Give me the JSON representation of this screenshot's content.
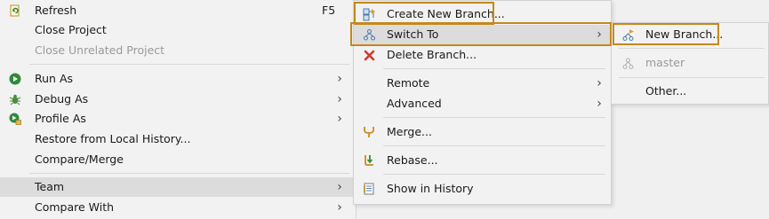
{
  "menu_main": {
    "refresh": {
      "label": "Refresh",
      "accel": "F5"
    },
    "close_project": {
      "label": "Close Project"
    },
    "close_unrelated": {
      "label": "Close Unrelated Project"
    },
    "run_as": {
      "label": "Run As",
      "arrow": "›"
    },
    "debug_as": {
      "label": "Debug As",
      "arrow": "›"
    },
    "profile_as": {
      "label": "Profile As",
      "arrow": "›"
    },
    "restore_history": {
      "label": "Restore from Local History..."
    },
    "compare_merge": {
      "label": "Compare/Merge"
    },
    "team": {
      "label": "Team",
      "arrow": "›"
    },
    "compare_with": {
      "label": "Compare With",
      "arrow": "›"
    }
  },
  "menu_team": {
    "create_branch": {
      "label": "Create New Branch..."
    },
    "switch_to": {
      "label": "Switch To",
      "arrow": "›"
    },
    "delete_branch": {
      "label": "Delete Branch..."
    },
    "remote": {
      "label": "Remote",
      "arrow": "›"
    },
    "advanced": {
      "label": "Advanced",
      "arrow": "›"
    },
    "merge": {
      "label": "Merge..."
    },
    "rebase": {
      "label": "Rebase..."
    },
    "show_history": {
      "label": "Show in History"
    }
  },
  "menu_switch": {
    "new_branch": {
      "label": "New Branch..."
    },
    "master": {
      "label": "master"
    },
    "other": {
      "label": "Other..."
    }
  },
  "colors": {
    "highlight_border": "#c4881c",
    "menu_background": "#f2f2f2",
    "selection": "#dcdcdc",
    "disabled_text": "#9a9a9a"
  }
}
